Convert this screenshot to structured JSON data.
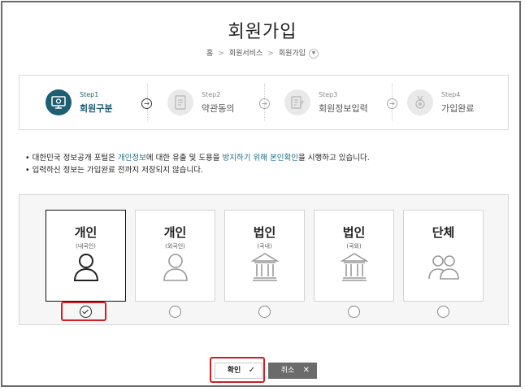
{
  "page": {
    "title": "회원가입"
  },
  "breadcrumb": {
    "items": [
      "홈",
      "회원서비스",
      "회원가입"
    ],
    "separator": ">",
    "dropdown_icon": "chevron-down-icon"
  },
  "steps": [
    {
      "num": "Step1",
      "label": "회원구분",
      "icon": "monitor-icon",
      "active": true
    },
    {
      "num": "Step2",
      "label": "약관동의",
      "icon": "document-icon",
      "active": false
    },
    {
      "num": "Step3",
      "label": "회원정보입력",
      "icon": "form-icon",
      "active": false
    },
    {
      "num": "Step4",
      "label": "가입완료",
      "icon": "medal-icon",
      "active": false
    }
  ],
  "step_arrow": "→",
  "notice": {
    "line1": {
      "bullet": "•",
      "p1": "대한민국 정보공개 포털은 ",
      "h1": "개인정보",
      "p2": "에 대한 유출 및 도용을 ",
      "h2": "방지하기 위해 본인확인",
      "p3": "을 시행하고 있습니다."
    },
    "line2": {
      "bullet": "•",
      "text": "입력하신 정보는 가입완료 전까지 저장되지 않습니다."
    }
  },
  "member_types": [
    {
      "title": "개인",
      "sub": "(내국인)",
      "icon": "person-icon",
      "selected": true
    },
    {
      "title": "개인",
      "sub": "(외국인)",
      "icon": "person-icon",
      "selected": false
    },
    {
      "title": "법인",
      "sub": "(국내)",
      "icon": "building-icon",
      "selected": false
    },
    {
      "title": "법인",
      "sub": "(국외)",
      "icon": "building-icon",
      "selected": false
    },
    {
      "title": "단체",
      "sub": "",
      "icon": "group-icon",
      "selected": false
    }
  ],
  "buttons": {
    "confirm": {
      "label": "확인",
      "icon": "✓"
    },
    "cancel": {
      "label": "취소",
      "icon": "✕"
    }
  },
  "colors": {
    "accent": "#1e5e73",
    "highlight_text": "#1e6c84",
    "annotation": "#d21d22"
  }
}
